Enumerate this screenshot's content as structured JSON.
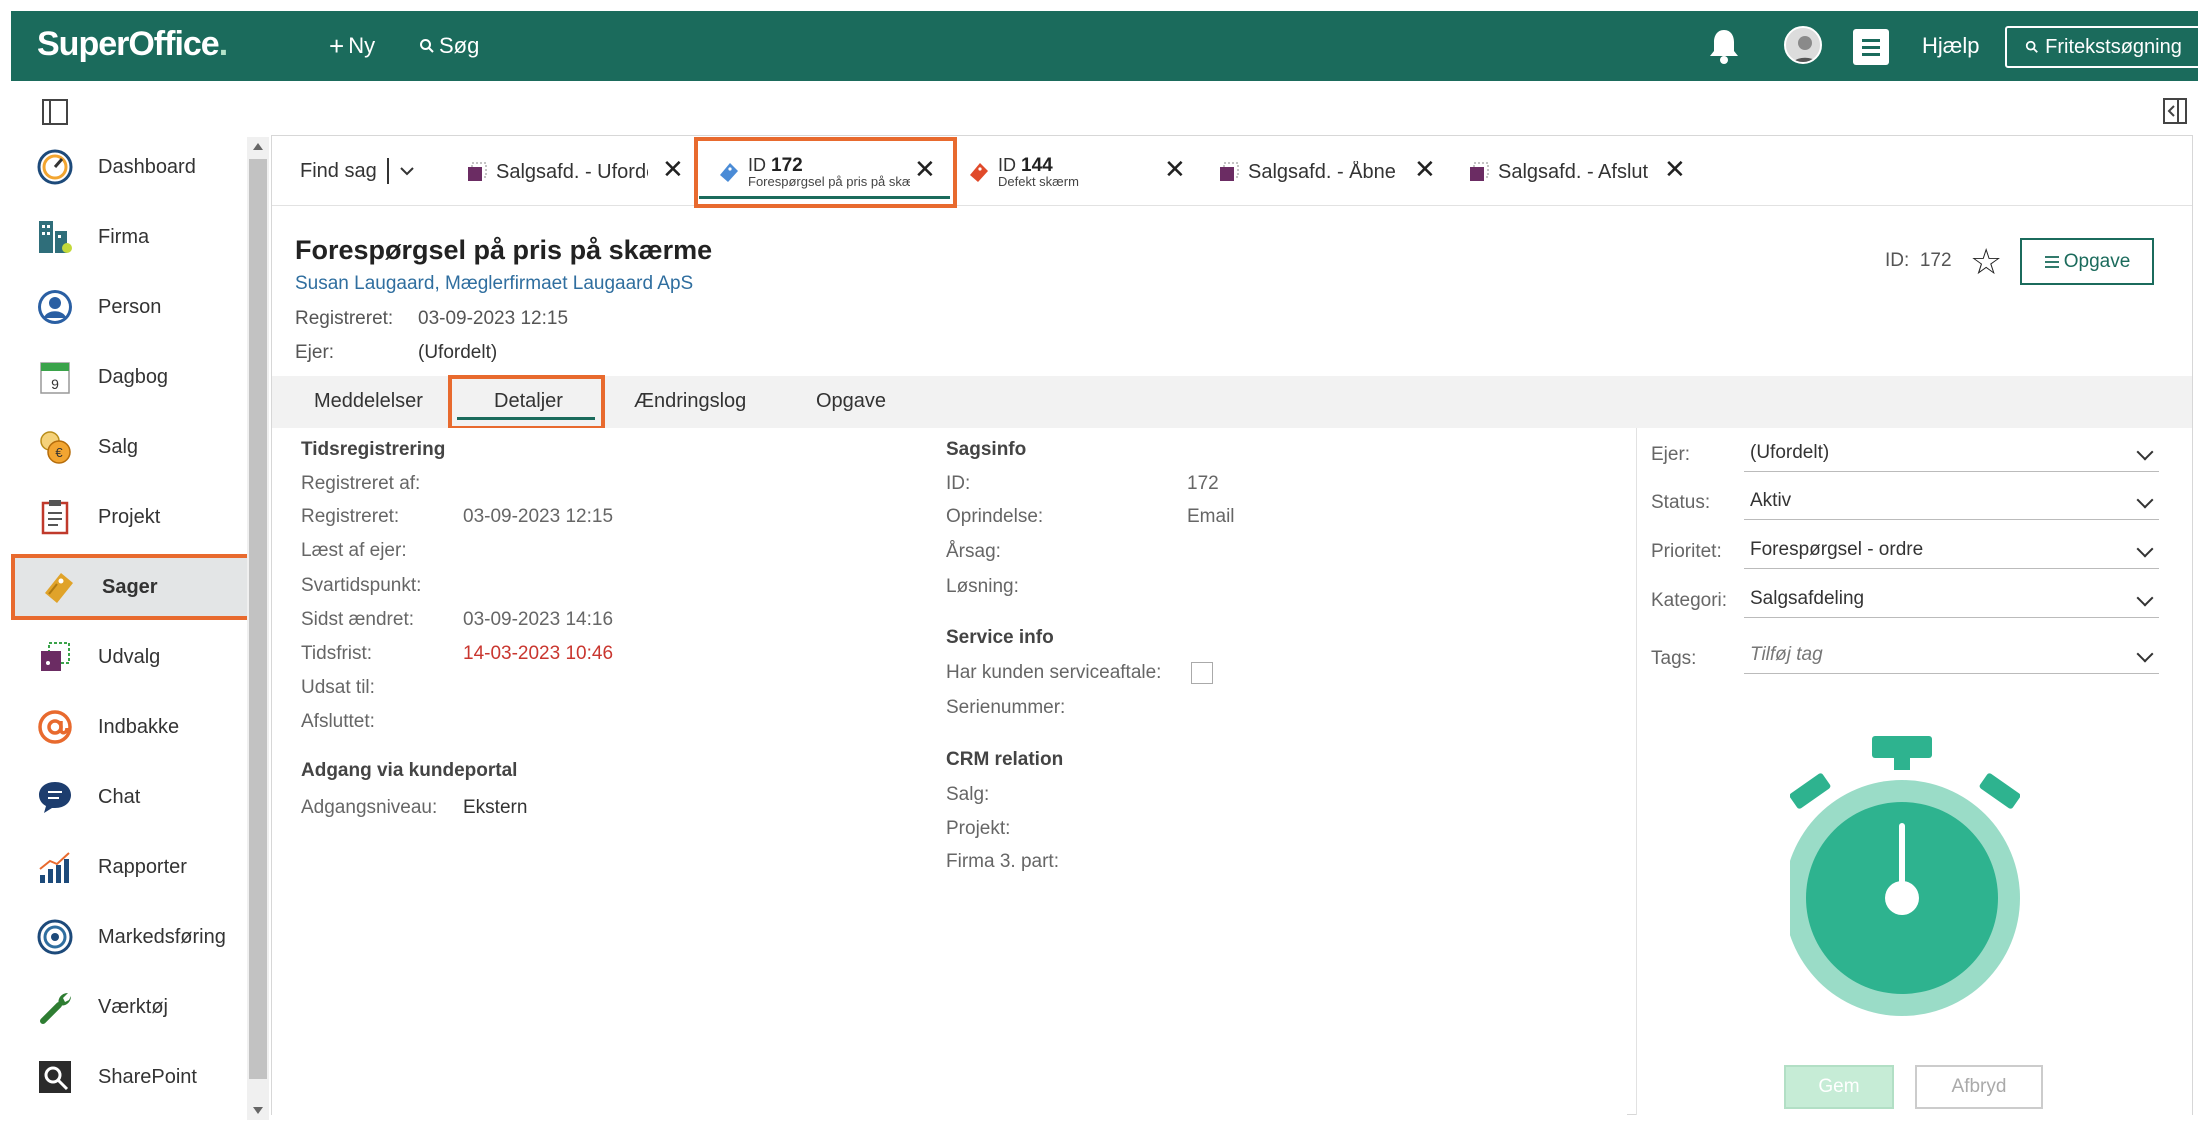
{
  "app": {
    "logo": "SuperOffice",
    "logo_dot": ".",
    "new_label": "Ny",
    "search_label": "Søg",
    "help_label": "Hjælp",
    "freetext_label": "Fritekstsøgning"
  },
  "sidebar": {
    "items": [
      {
        "label": "Dashboard",
        "icon": "dashboard-icon"
      },
      {
        "label": "Firma",
        "icon": "company-icon"
      },
      {
        "label": "Person",
        "icon": "person-icon"
      },
      {
        "label": "Dagbog",
        "icon": "calendar-icon",
        "icon_text": "9"
      },
      {
        "label": "Salg",
        "icon": "sales-icon"
      },
      {
        "label": "Projekt",
        "icon": "project-icon"
      },
      {
        "label": "Sager",
        "icon": "ticket-icon",
        "active": true
      },
      {
        "label": "Udvalg",
        "icon": "selection-icon"
      },
      {
        "label": "Indbakke",
        "icon": "inbox-icon"
      },
      {
        "label": "Chat",
        "icon": "chat-icon"
      },
      {
        "label": "Rapporter",
        "icon": "reports-icon"
      },
      {
        "label": "Markedsføring",
        "icon": "marketing-icon"
      },
      {
        "label": "Værktøj",
        "icon": "tools-icon"
      },
      {
        "label": "SharePoint",
        "icon": "sharepoint-icon"
      }
    ]
  },
  "tabs": {
    "find_label": "Find sag",
    "items": [
      {
        "title": "Salgsafd. - Ufordelt",
        "icon": "selection-icon"
      },
      {
        "id_prefix": "ID",
        "id": "172",
        "subtitle": "Forespørgsel på pris på skærme",
        "icon": "ticket-blue-icon",
        "active": true
      },
      {
        "id_prefix": "ID",
        "id": "144",
        "subtitle": "Defekt skærm",
        "icon": "ticket-red-icon"
      },
      {
        "title": "Salgsafd. - Åbne sager",
        "icon": "selection-icon"
      },
      {
        "title": "Salgsafd. - Afslut.",
        "icon": "selection-icon"
      }
    ]
  },
  "case": {
    "title": "Forespørgsel på pris på skærme",
    "contact": "Susan Laugaard, Mæglerfirmaet Laugaard ApS",
    "registered_label": "Registreret:",
    "registered_value": "03-09-2023 12:15",
    "owner_label": "Ejer:",
    "owner_value": "(Ufordelt)",
    "id_label": "ID:",
    "id_value": "172",
    "task_button": "Opgave"
  },
  "subtabs": [
    "Meddelelser",
    "Detaljer",
    "Ændringslog",
    "Opgave"
  ],
  "details": {
    "time_section": "Tidsregistrering",
    "time_fields": [
      {
        "label": "Registreret af:",
        "value": ""
      },
      {
        "label": "Registreret:",
        "value": "03-09-2023 12:15"
      },
      {
        "label": "Læst af ejer:",
        "value": ""
      },
      {
        "label": "Svartidspunkt:",
        "value": ""
      },
      {
        "label": "Sidst ændret:",
        "value": "03-09-2023 14:16"
      },
      {
        "label": "Tidsfrist:",
        "value": "14-03-2023 10:46"
      },
      {
        "label": "Udsat til:",
        "value": ""
      },
      {
        "label": "Afsluttet:",
        "value": ""
      }
    ],
    "portal_section": "Adgang via kundeportal",
    "portal_label": "Adgangsniveau:",
    "portal_value": "Ekstern",
    "info_section": "Sagsinfo",
    "info_fields": [
      {
        "label": "ID:",
        "value": "172"
      },
      {
        "label": "Oprindelse:",
        "value": "Email"
      },
      {
        "label": "Årsag:",
        "value": ""
      },
      {
        "label": "Løsning:",
        "value": ""
      }
    ],
    "service_section": "Service info",
    "service_agreement_label": "Har kunden serviceaftale:",
    "serial_label": "Serienummer:",
    "crm_section": "CRM relation",
    "crm_fields": [
      "Salg:",
      "Projekt:",
      "Firma 3. part:"
    ]
  },
  "panel": {
    "owner_label": "Ejer:",
    "owner_value": "(Ufordelt)",
    "status_label": "Status:",
    "status_value": "Aktiv",
    "priority_label": "Prioritet:",
    "priority_value": "Forespørgsel - ordre",
    "category_label": "Kategori:",
    "category_value": "Salgsafdeling",
    "tags_label": "Tags:",
    "tags_placeholder": "Tilføj tag",
    "save_label": "Gem",
    "cancel_label": "Afbryd"
  },
  "colors": {
    "brand": "#1b6b5c",
    "highlight": "#e86a2e",
    "deadline": "#c9362f",
    "stopwatch": "#2eb38f"
  }
}
